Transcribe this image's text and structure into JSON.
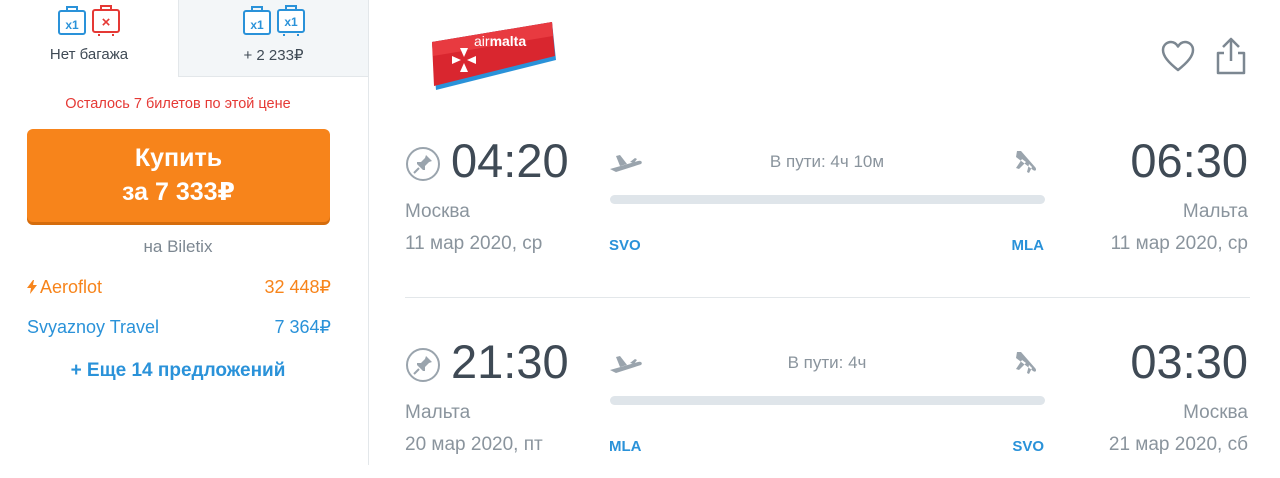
{
  "baggage": {
    "tabs": [
      {
        "label": "Нет багажа",
        "icons": [
          "hand-luggage-x1-icon",
          "suitcase-none-icon"
        ],
        "badge_hand": "x1",
        "badge_bag": "×"
      },
      {
        "label": "+ 2 233₽",
        "icons": [
          "hand-luggage-x1-icon",
          "suitcase-x1-icon"
        ],
        "badge_hand": "x1",
        "badge_bag": "x1"
      }
    ]
  },
  "offer": {
    "tickets_left": "Осталось 7 билетов по этой цене",
    "buy_line1": "Купить",
    "buy_line2": "за 7 333₽",
    "agent": "на Biletix",
    "alternatives": [
      {
        "name": "Aeroflot",
        "price": "32 448₽",
        "icon": "lightning-icon"
      },
      {
        "name": "Svyaznoy Travel",
        "price": "7 364₽"
      }
    ],
    "more": "+ Еще 14 предложений"
  },
  "airline": {
    "logo_text": "airmalta",
    "logo_prefix": "air",
    "logo_suffix": "malta"
  },
  "segments": [
    {
      "dep_time": "04:20",
      "dep_city": "Москва",
      "dep_date": "11 мар 2020, ср",
      "dep_iata": "SVO",
      "arr_time": "06:30",
      "arr_city": "Мальта",
      "arr_date": "11 мар 2020, ср",
      "arr_iata": "MLA",
      "duration": "В пути: 4ч 10м"
    },
    {
      "dep_time": "21:30",
      "dep_city": "Мальта",
      "dep_date": "20 мар 2020, пт",
      "dep_iata": "MLA",
      "arr_time": "03:30",
      "arr_city": "Москва",
      "arr_date": "21 мар 2020, сб",
      "arr_iata": "SVO",
      "duration": "В пути: 4ч"
    }
  ],
  "colors": {
    "accent_orange": "#f7841b",
    "link_blue": "#2a92d9",
    "warning_red": "#e53935",
    "text_main": "#3f4a55",
    "text_muted": "#8a949d"
  }
}
